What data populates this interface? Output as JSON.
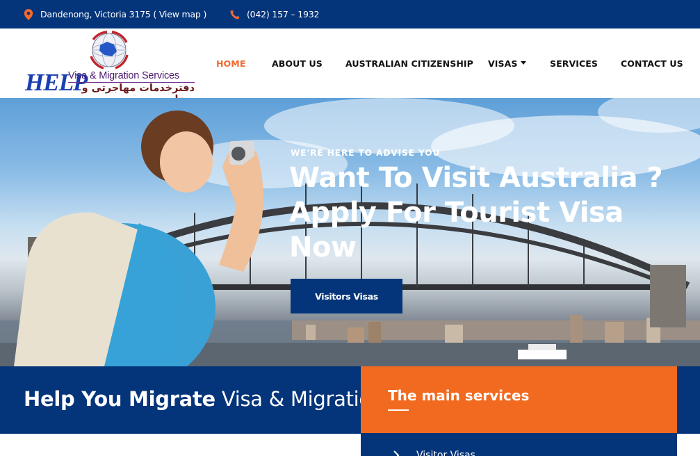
{
  "topbar": {
    "location": "Dandenong, Victoria 3175 ( View map )",
    "location_icon": "map-pin-icon",
    "phone": "(042) 157 – 1932",
    "phone_icon": "phone-icon",
    "accent_color": "#f26a2e"
  },
  "logo": {
    "help": "HELP",
    "subtitle": "Visa & Migration Services",
    "farsi": "دفترخدمات مهاجرتی و ویزا"
  },
  "nav": {
    "items": [
      {
        "label": "HOME",
        "active": true
      },
      {
        "label": "ABOUT US"
      },
      {
        "label": "AUSTRALIAN CITIZENSHIP"
      },
      {
        "label": "VISAS",
        "has_dropdown": true
      },
      {
        "label": "SERVICES"
      },
      {
        "label": "CONTACT US"
      }
    ]
  },
  "hero": {
    "eyebrow": "WE'RE HERE TO ADVISE YOU",
    "headline_1": "Want To Visit Australia ?",
    "headline_2": "Apply For Tourist Visa",
    "headline_3": "Now",
    "cta_label": "Visitors Visas"
  },
  "band": {
    "bold": "Help You Migrate",
    "light": "Visa & Migration"
  },
  "services": {
    "title": "The main services",
    "first_item": "Visitor Visas"
  },
  "colors": {
    "primary": "#04357a",
    "accent": "#f26a1f"
  }
}
